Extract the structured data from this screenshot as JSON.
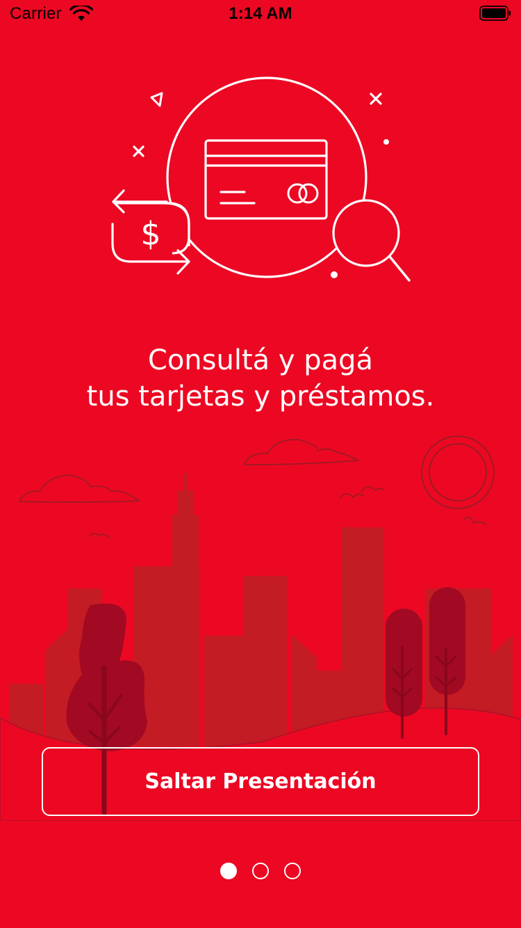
{
  "status_bar": {
    "carrier": "Carrier",
    "time": "1:14 AM",
    "icons": [
      "wifi-icon",
      "battery-icon"
    ]
  },
  "hero": {
    "icons": [
      "credit-card-icon",
      "dollar-exchange-icon",
      "magnifier-icon"
    ]
  },
  "onboarding": {
    "title_line1": "Consultá y pagá",
    "title_line2": "tus tarjetas y préstamos."
  },
  "skip_button": {
    "label": "Saltar Presentación"
  },
  "pager": {
    "total": 3,
    "active_index": 0
  },
  "colors": {
    "background": "#EC0823",
    "foreground": "#FFFFFF",
    "buildings": "#C41C24",
    "trees": "#A10A22"
  }
}
